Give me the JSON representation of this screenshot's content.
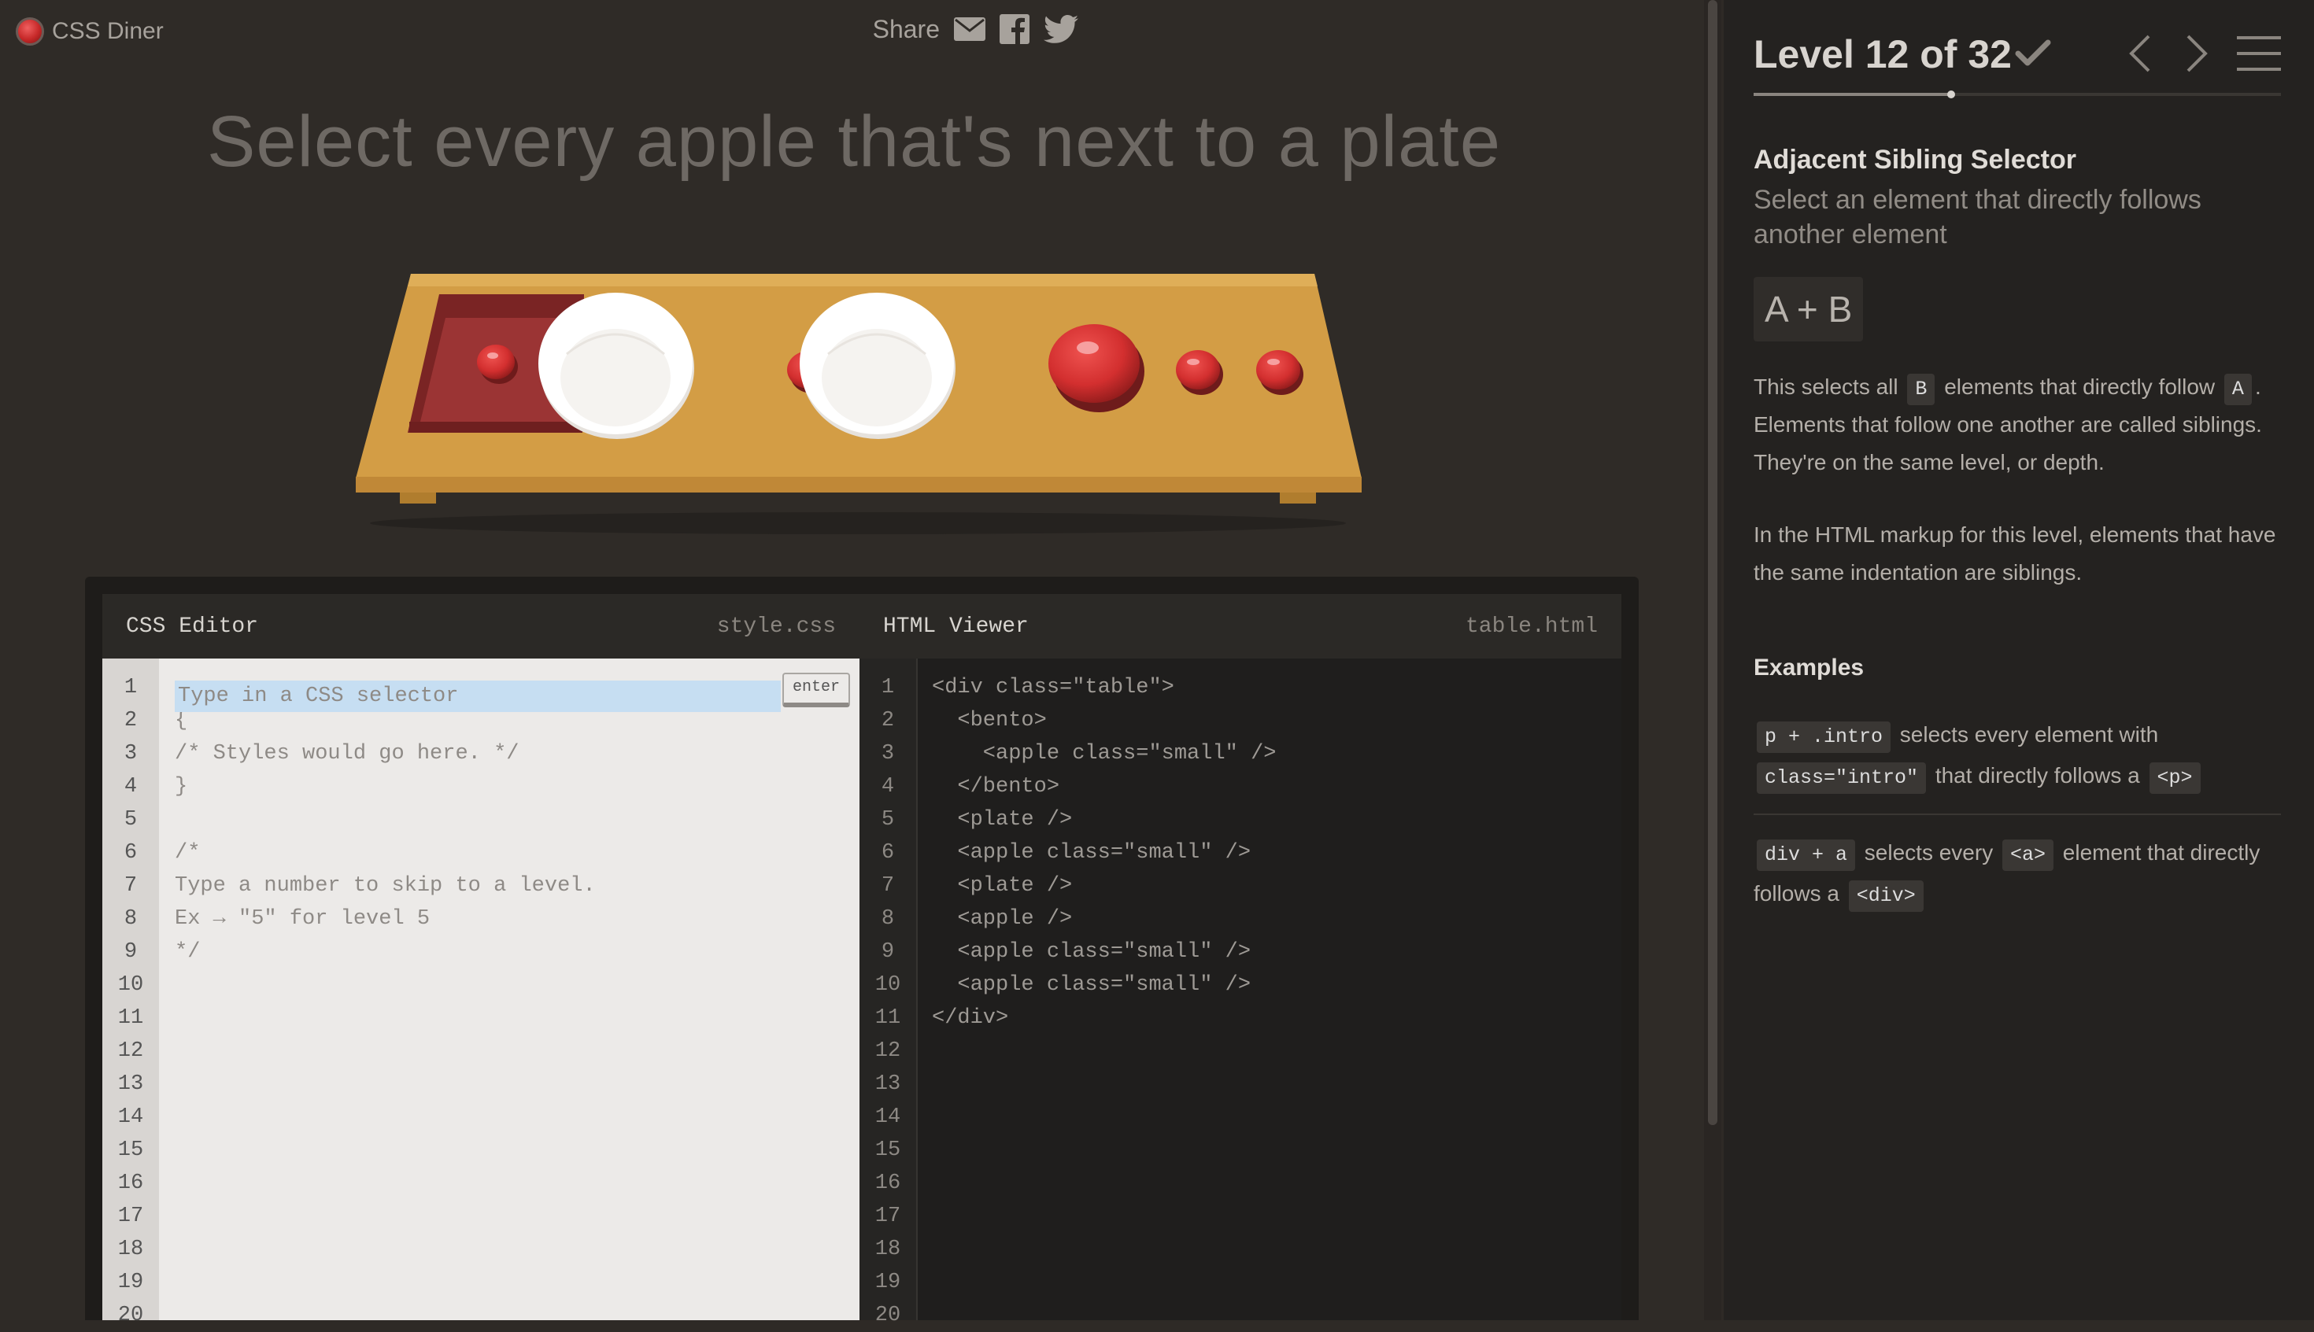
{
  "app": {
    "name": "CSS Diner"
  },
  "share": {
    "label": "Share",
    "icons": [
      "email-icon",
      "facebook-icon",
      "twitter-icon"
    ]
  },
  "level": {
    "instruction": "Select every apple that's next to a plate",
    "header": "Level 12 of 32",
    "current": 12,
    "total": 32,
    "completed": true
  },
  "table_items": [
    "bento-with-small-apple",
    "plate",
    "small-apple",
    "plate",
    "apple",
    "small-apple",
    "small-apple"
  ],
  "css_editor": {
    "title": "CSS Editor",
    "file": "style.css",
    "placeholder": "Type in a CSS selector",
    "enter_label": "enter",
    "line_numbers": [
      "1",
      "2",
      "3",
      "4",
      "5",
      "6",
      "7",
      "8",
      "9",
      "10",
      "11",
      "12",
      "13",
      "14",
      "15",
      "16",
      "17",
      "18",
      "19",
      "20"
    ],
    "lines": [
      "",
      "{",
      "/* Styles would go here. */",
      "}",
      "",
      "/*",
      "Type a number to skip to a level.",
      "Ex → \"5\" for level 5",
      "*/"
    ]
  },
  "html_viewer": {
    "title": "HTML Viewer",
    "file": "table.html",
    "line_numbers": [
      "1",
      "2",
      "3",
      "4",
      "5",
      "6",
      "7",
      "8",
      "9",
      "10",
      "11",
      "12",
      "13",
      "14",
      "15",
      "16",
      "17",
      "18",
      "19",
      "20"
    ],
    "lines": [
      "<div class=\"table\">",
      "  <bento>",
      "    <apple class=\"small\" />",
      "  </bento>",
      "  <plate />",
      "  <apple class=\"small\" />",
      "  <plate />",
      "  <apple />",
      "  <apple class=\"small\" />",
      "  <apple class=\"small\" />",
      "</div>"
    ]
  },
  "sidebar": {
    "selector_name": "Adjacent Sibling Selector",
    "selector_desc": "Select an element that directly follows another element",
    "syntax": "A + B",
    "para1": {
      "a": "This selects all ",
      "tag1": "B",
      "b": " elements that directly follow ",
      "tag2": "A",
      "c": ". Elements that follow one another are called siblings. They're on the same level, or depth."
    },
    "para2": "In the HTML markup for this level, elements that have the same indentation are siblings.",
    "examples_title": "Examples",
    "examples": [
      {
        "code": "p + .intro",
        "text1": " selects every element with ",
        "code2": "class=\"intro\"",
        "text2": " that directly follows a ",
        "code3": "<p>"
      },
      {
        "code": "div + a",
        "text1": " selects every ",
        "code2": "<a>",
        "text2": " element that directly follows a ",
        "code3": "<div>"
      }
    ]
  },
  "colors": {
    "background": "#2f2b27",
    "sidebar": "#242220",
    "table_wood": "#d19a3e",
    "apple_red": "#d32f2f",
    "bento_red": "#8e2a2a",
    "plate_white": "#ffffff",
    "input_highlight": "#c6def2"
  }
}
